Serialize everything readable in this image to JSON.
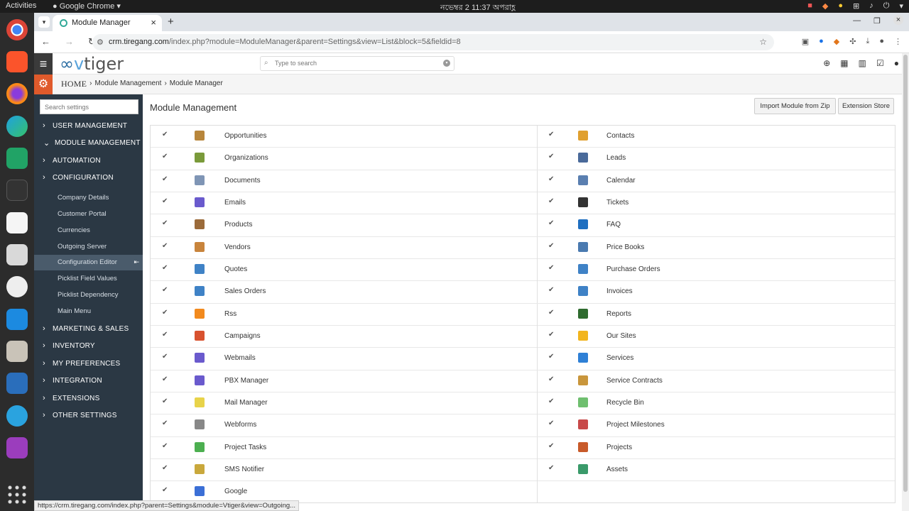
{
  "desktop": {
    "activities": "Activities",
    "app_name": "Google Chrome",
    "clock": "নভেম্বর 2  11:37 অপরাহ্ণ"
  },
  "browser": {
    "tab_title": "Module Manager",
    "url_host": "crm.tiregang.com",
    "url_path": "/index.php?module=ModuleManager&parent=Settings&view=List&block=5&fieldid=8",
    "status_url": "https://crm.tiregang.com/index.php?parent=Settings&module=Vtiger&view=Outgoing..."
  },
  "app": {
    "logo_v": "v",
    "logo_rest": "tiger",
    "search_placeholder": "Type to search"
  },
  "breadcrumb": {
    "home": "HOME",
    "level1": "Module Management",
    "level2": "Module Manager"
  },
  "sidebar": {
    "search_placeholder": "Search settings",
    "user_management": "USER MANAGEMENT",
    "module_management": "MODULE MANAGEMENT",
    "automation": "AUTOMATION",
    "configuration": "CONFIGURATION",
    "config_items": [
      "Company Details",
      "Customer Portal",
      "Currencies",
      "Outgoing Server",
      "Configuration Editor",
      "Picklist Field Values",
      "Picklist Dependency",
      "Main Menu"
    ],
    "marketing_sales": "MARKETING & SALES",
    "inventory": "INVENTORY",
    "my_preferences": "MY PREFERENCES",
    "integration": "INTEGRATION",
    "extensions": "EXTENSIONS",
    "other_settings": "OTHER SETTINGS"
  },
  "main": {
    "title": "Module Management",
    "import_button": "Import Module from Zip",
    "store_button": "Extension Store",
    "left_modules": [
      {
        "name": "Opportunities",
        "color": "#b8863b"
      },
      {
        "name": "Organizations",
        "color": "#7a9a3a"
      },
      {
        "name": "Documents",
        "color": "#7f95b5"
      },
      {
        "name": "Emails",
        "color": "#6a5acd"
      },
      {
        "name": "Products",
        "color": "#9b6b3a"
      },
      {
        "name": "Vendors",
        "color": "#c8843c"
      },
      {
        "name": "Quotes",
        "color": "#3f82c6"
      },
      {
        "name": "Sales Orders",
        "color": "#3f82c6"
      },
      {
        "name": "Rss",
        "color": "#f28a1e"
      },
      {
        "name": "Campaigns",
        "color": "#d8522f"
      },
      {
        "name": "Webmails",
        "color": "#6a5acd"
      },
      {
        "name": "PBX Manager",
        "color": "#6a5acd"
      },
      {
        "name": "Mail Manager",
        "color": "#e8d34a"
      },
      {
        "name": "Webforms",
        "color": "#888888"
      },
      {
        "name": "Project Tasks",
        "color": "#4caf50"
      },
      {
        "name": "SMS Notifier",
        "color": "#c9a83c"
      },
      {
        "name": "Google",
        "color": "#3b6fd6"
      }
    ],
    "right_modules": [
      {
        "name": "Contacts",
        "color": "#e0a030"
      },
      {
        "name": "Leads",
        "color": "#4a6a9a"
      },
      {
        "name": "Calendar",
        "color": "#5a7fb0"
      },
      {
        "name": "Tickets",
        "color": "#333333"
      },
      {
        "name": "FAQ",
        "color": "#1f6fc0"
      },
      {
        "name": "Price Books",
        "color": "#4a7ab0"
      },
      {
        "name": "Purchase Orders",
        "color": "#3f82c6"
      },
      {
        "name": "Invoices",
        "color": "#3f82c6"
      },
      {
        "name": "Reports",
        "color": "#2f6b2f"
      },
      {
        "name": "Our Sites",
        "color": "#f2b51e"
      },
      {
        "name": "Services",
        "color": "#2f80d6"
      },
      {
        "name": "Service Contracts",
        "color": "#c9963c"
      },
      {
        "name": "Recycle Bin",
        "color": "#6fbf6f"
      },
      {
        "name": "Project Milestones",
        "color": "#c84a4a"
      },
      {
        "name": "Projects",
        "color": "#c85a2a"
      },
      {
        "name": "Assets",
        "color": "#3a9a6a"
      }
    ]
  },
  "colors": {
    "sidebar_bg": "#2b3844",
    "accent": "#e05a2b",
    "logo_blue": "#2d6ea3"
  }
}
